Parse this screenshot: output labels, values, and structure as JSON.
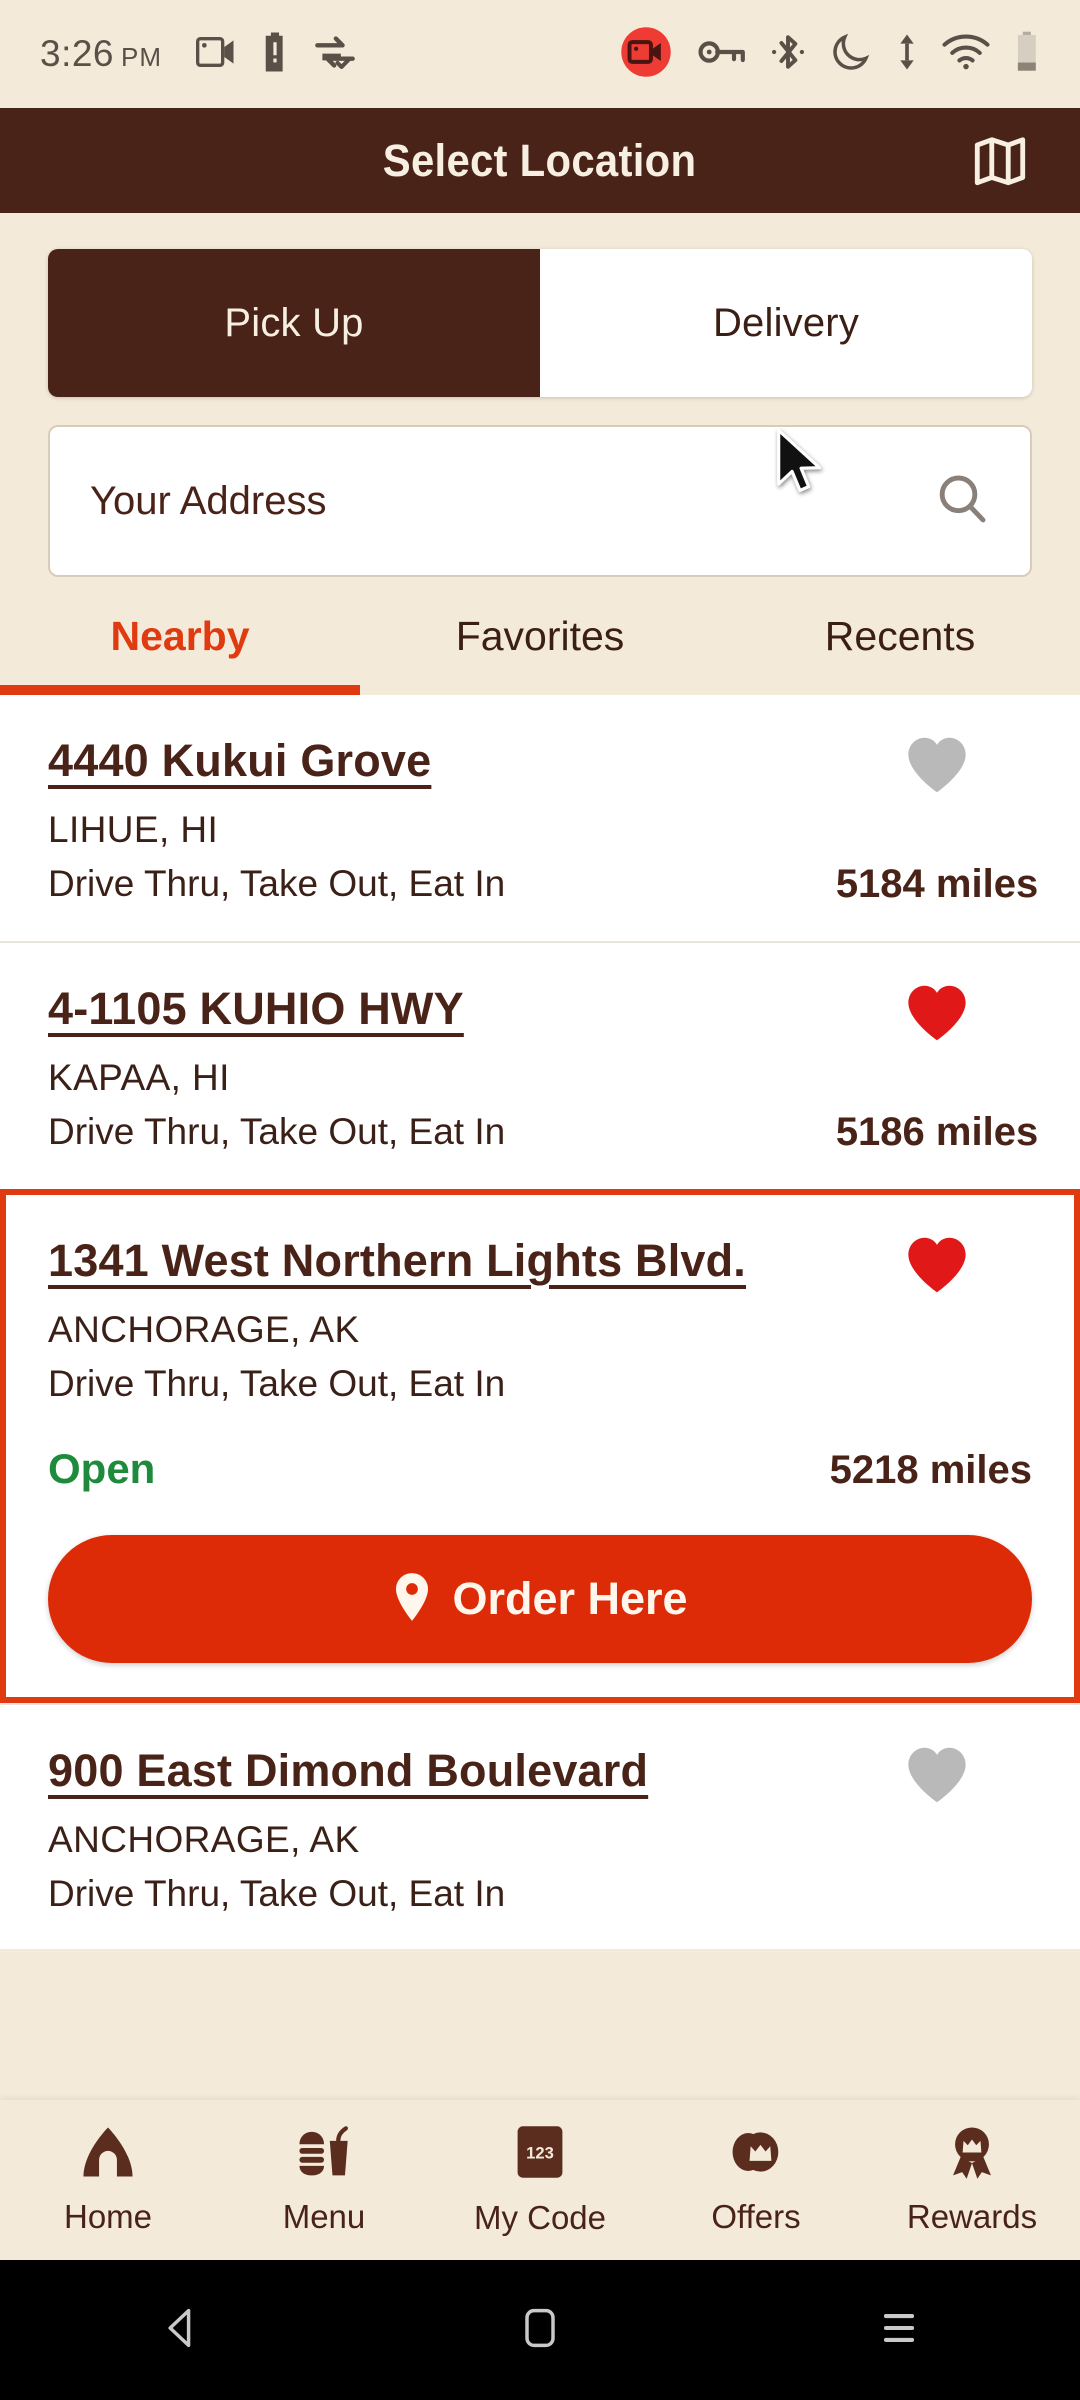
{
  "status_bar": {
    "time": "3:26",
    "ampm": "PM",
    "left_icons": [
      "screen-record-icon",
      "battery-alert-icon",
      "data-saver-icon"
    ],
    "right_icons": [
      "screen-record-active-icon",
      "vpn-key-icon",
      "bluetooth-icon",
      "do-not-disturb-moon-icon",
      "sync-arrows-icon",
      "wifi-icon",
      "battery-icon"
    ]
  },
  "header": {
    "title": "Select Location",
    "map_icon": "map-icon"
  },
  "mode_toggle": {
    "options": [
      {
        "label": "Pick Up",
        "selected": true
      },
      {
        "label": "Delivery",
        "selected": false
      }
    ]
  },
  "search": {
    "placeholder": "Your Address",
    "value": "",
    "icon": "search-icon"
  },
  "tabs": [
    {
      "label": "Nearby",
      "active": true
    },
    {
      "label": "Favorites",
      "active": false
    },
    {
      "label": "Recents",
      "active": false
    }
  ],
  "locations": [
    {
      "address": "4440 Kukui Grove",
      "city": "LIHUE, HI",
      "services": "Drive Thru, Take Out, Eat In",
      "distance": "5184 miles",
      "favorite": false,
      "status": "",
      "highlighted": false,
      "order_button": ""
    },
    {
      "address": "4-1105 KUHIO HWY",
      "city": "KAPAA, HI",
      "services": "Drive Thru, Take Out, Eat In",
      "distance": "5186 miles",
      "favorite": true,
      "status": "",
      "highlighted": false,
      "order_button": ""
    },
    {
      "address": "1341 West Northern Lights Blvd.",
      "city": "ANCHORAGE, AK",
      "services": "Drive Thru, Take Out, Eat In",
      "distance": "5218 miles",
      "favorite": true,
      "status": "Open",
      "highlighted": true,
      "order_button": "Order Here"
    },
    {
      "address": "900 East Dimond Boulevard",
      "city": "ANCHORAGE, AK",
      "services": "Drive Thru, Take Out, Eat In",
      "distance": "",
      "favorite": false,
      "status": "",
      "highlighted": false,
      "order_button": ""
    }
  ],
  "bottom_nav": [
    {
      "label": "Home",
      "icon": "home-icon"
    },
    {
      "label": "Menu",
      "icon": "sandwich-drink-icon"
    },
    {
      "label": "My Code",
      "icon": "barcode-card-icon",
      "badge": "123"
    },
    {
      "label": "Offers",
      "icon": "offers-coin-icon"
    },
    {
      "label": "Rewards",
      "icon": "rewards-medal-icon"
    }
  ],
  "system_nav": [
    {
      "icon": "back-triangle-icon"
    },
    {
      "icon": "home-square-icon"
    },
    {
      "icon": "recents-menu-icon"
    }
  ],
  "colors": {
    "brand_brown": "#4A2318",
    "cream": "#F4EADA",
    "accent_red": "#E03A10",
    "button_red": "#DD2B08",
    "open_green": "#1E8B3C",
    "heart_red": "#E11818",
    "heart_gray": "#B9B9B9"
  }
}
